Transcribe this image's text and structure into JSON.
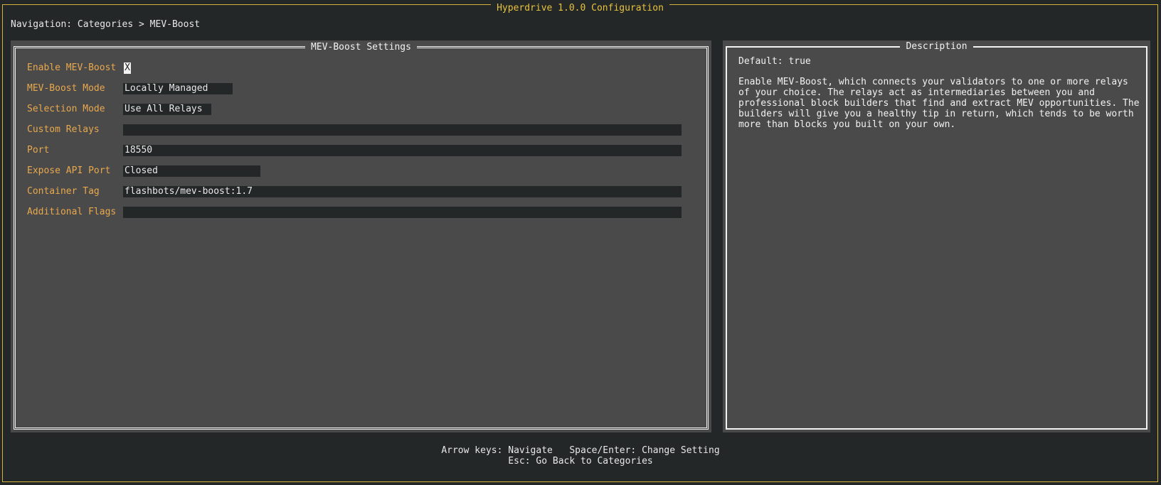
{
  "window": {
    "title": "Hyperdrive 1.0.0 Configuration"
  },
  "navigation": {
    "text": "Navigation: Categories > MEV-Boost"
  },
  "settings_panel": {
    "title": "MEV-Boost Settings",
    "enable": {
      "label": "Enable MEV-Boost",
      "value": "X"
    },
    "mode": {
      "label": "MEV-Boost Mode",
      "value": "Locally Managed"
    },
    "selection": {
      "label": "Selection Mode",
      "value": "Use All Relays"
    },
    "custom_relays": {
      "label": "Custom Relays",
      "value": ""
    },
    "port": {
      "label": "Port",
      "value": "18550"
    },
    "expose_api": {
      "label": "Expose API Port",
      "value": "Closed"
    },
    "container_tag": {
      "label": "Container Tag",
      "value": "flashbots/mev-boost:1.7"
    },
    "additional_flags": {
      "label": "Additional Flags",
      "value": ""
    }
  },
  "description_panel": {
    "title": "Description",
    "default": "Default: true",
    "body": "Enable MEV-Boost, which connects your validators to one or more relays of your choice. The relays act as intermediaries between you and professional block builders that find and extract MEV opportunities. The builders will give you a healthy tip in return, which tends to be worth more than blocks you built on your own."
  },
  "help": {
    "line1": "Arrow keys: Navigate   Space/Enter: Change Setting",
    "line2": "Esc: Go Back to Categories"
  },
  "colors": {
    "background": "#232728",
    "panel": "#4a4a4a",
    "accent_border": "#d6b23a",
    "label": "#e8a84d"
  }
}
